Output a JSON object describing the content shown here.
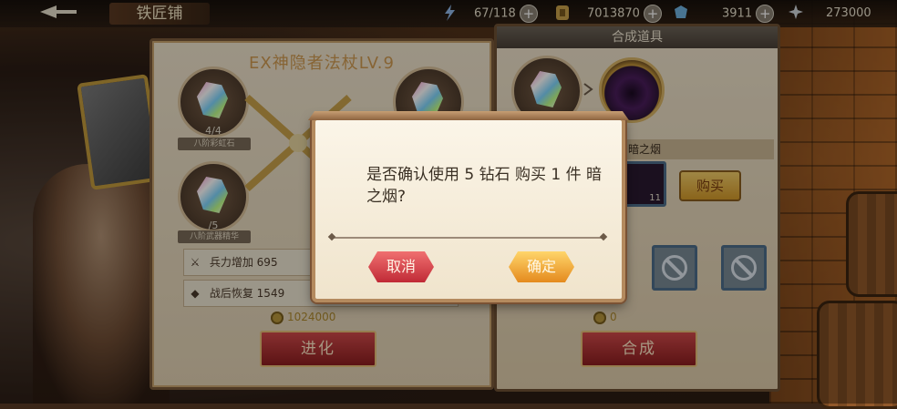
{
  "header": {
    "title": "铁匠铺",
    "energy": "67/118",
    "gold": "7013870",
    "diamond": "3911",
    "stars": "273000",
    "plus_label": "+"
  },
  "left_panel": {
    "weapon_name": "EX神隐者法杖LV.9",
    "materials": [
      {
        "count": "4/4",
        "label": "八阶彩虹石"
      },
      {
        "count": "/5",
        "label": "八阶武器精华"
      }
    ],
    "stats": [
      {
        "label": "兵力增加",
        "value": "695"
      },
      {
        "label": "战后恢复",
        "value": "1549"
      }
    ],
    "cost": "1024000",
    "evolve_label": "进化"
  },
  "right_panel": {
    "title": "合成道具",
    "item_name": "暗之烟",
    "item_count": "11",
    "buy_label": "购买",
    "cost": "0",
    "synth_label": "合成"
  },
  "dialog": {
    "message": "是否确认使用 5 钻石 购买 1 件 暗之烟?",
    "cancel_label": "取消",
    "confirm_label": "确定"
  }
}
